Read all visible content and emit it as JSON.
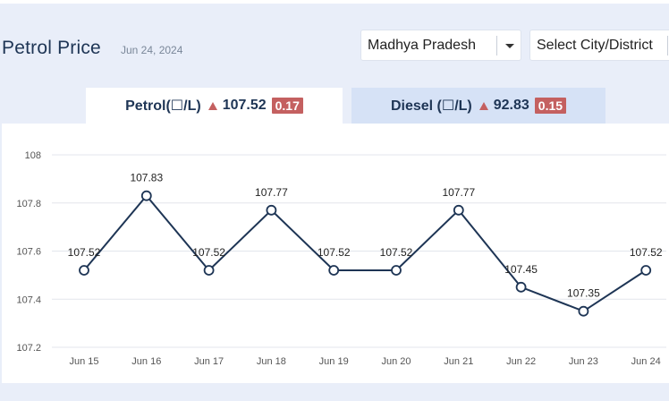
{
  "header": {
    "title": "Petrol Price",
    "date": "Jun 24, 2024"
  },
  "filters": {
    "state": "Madhya Pradesh",
    "city_placeholder": "Select City/District"
  },
  "tabs": [
    {
      "label": "Petrol(☐/L)",
      "price": "107.52",
      "change": "0.17",
      "active": true
    },
    {
      "label": "Diesel (☐/L)",
      "price": "92.83",
      "change": "0.15",
      "active": false
    }
  ],
  "colors": {
    "accent": "#1e3555",
    "badge": "#c46060",
    "inactive_tab": "#d6e2f6",
    "background": "#e9eef9"
  },
  "chart_data": {
    "type": "line",
    "categories": [
      "Jun 15",
      "Jun 16",
      "Jun 17",
      "Jun 18",
      "Jun 19",
      "Jun 20",
      "Jun 21",
      "Jun 22",
      "Jun 23",
      "Jun 24"
    ],
    "values": [
      107.52,
      107.83,
      107.52,
      107.77,
      107.52,
      107.52,
      107.77,
      107.45,
      107.35,
      107.52
    ],
    "data_labels": [
      "107.52",
      "107.83",
      "107.52",
      "107.77",
      "107.52",
      "107.52",
      "107.77",
      "107.45",
      "107.35",
      "107.52"
    ],
    "yticks": [
      "107.2",
      "107.4",
      "107.6",
      "107.8",
      "108"
    ],
    "ylim": [
      107.2,
      108.0
    ],
    "grid": true,
    "title": "",
    "xlabel": "",
    "ylabel": ""
  }
}
